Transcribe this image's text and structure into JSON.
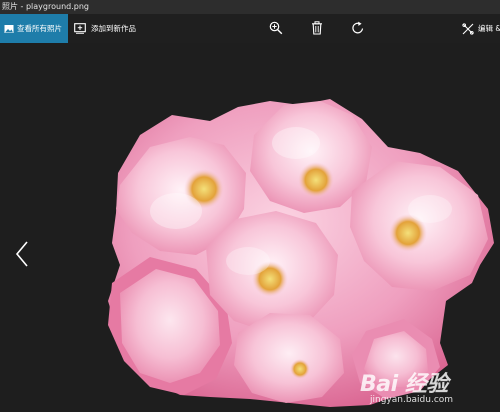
{
  "window": {
    "title": "照片 - playground.png"
  },
  "toolbar": {
    "view_all_label": "查看所有照片",
    "add_to_creation_label": "添加到新作品",
    "edit_label": "编辑 &"
  },
  "icons": {
    "view_all": "picture-icon",
    "add": "add-to-creation-icon",
    "zoom": "zoom-in-icon",
    "delete": "trash-icon",
    "rotate": "rotate-icon",
    "edit": "edit-icon",
    "prev": "chevron-left-icon"
  },
  "colors": {
    "accent": "#1e7daa",
    "background": "#1e1e1e",
    "toolbar": "#1f1f1f",
    "blossom": "#f4b7cd"
  },
  "watermark": {
    "logo": "Bai 经验",
    "url": "jingyan.baidu.com"
  }
}
